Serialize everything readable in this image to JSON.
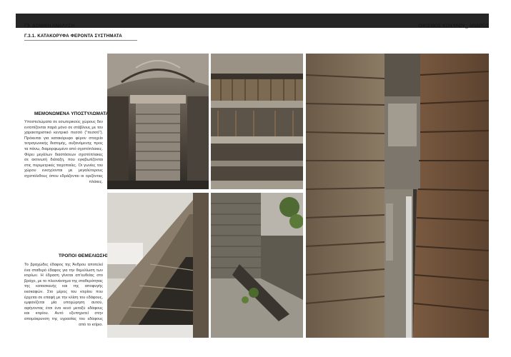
{
  "header": {
    "section": "Γ3. ΔΟΜΙΚΗ ΑΝΑΛΥΣΗ",
    "project": "ΟΙΚΙΣΜΟΣ ΚΟΧΥΛΟΥ_ ΑΝΔΡΟΣ"
  },
  "subsection": "Γ.3.1. ΚΑΤΑΚΟΡΥΦΑ ΦΕΡΟΝΤΑ ΣΥΣΤΗΜΑΤΑ",
  "blocks": {
    "columns": {
      "title": "ΜΕΜΟΝΩΜΕΝΑ ΥΠΟΣΤΥΛΩΜΑΤΑ",
      "text": "Υποστυλώματα σε εσωτερικούς χώρους δεν εντοπίζονται παρά μόνο σε στάβλους με τον χαρακτηριστικό κεντρικό πεσσό (\"πεσσό\"). Πρόκειται για κατακόρυφο φέρον στοιχείο τετραγωνικής διατομής, αυξανόμενης προς τα πάνω, διαμορφωμένο από σχιστόπλακες. Φέρει μεγάλων διαστάσεων σχιστόπλακες σε ακτινωτή διάταξη, που εγκιβωτίζονται στις περιμετρικές τοιχοποιίες. Οι γωνίες του χώρου ενισχύονται με μεγαλύτερους σχιστόλιθους όπου εδράζονται οι οριζόντιες πλάκες."
    },
    "foundation": {
      "title": "ΤΡΟΠΟΙ ΘΕΜΕΛΙΩΣΗΣ",
      "text": "Το βραχώδες έδαφος της Άνδρου αποτελεί ένα σταθερό έδαφος για την θεμελίωση των κτιρίων. Η έδραση γίνεται απ'ευθείας στο βράχο, με το πλεονέκτημα της σταθερότητας της κατασκευής και της αποφυγής εκσκαφών. Στο μέρος του κτιρίου που έρχεται σε επαφή με την κλίση του εδάφους, εμφανίζεται μία υποχώρηση αυτού, αφήνοντας έτσι ένα κενό μεταξύ εδάφους και κτιρίου. Αυτό εξυπηρετεί στην απομάκρυνση της υγρασίας του εδάφους από το κτίριο."
    }
  },
  "colors": {
    "topbar": "#262626",
    "rule": "#8a8a8a",
    "text": "#333333"
  }
}
